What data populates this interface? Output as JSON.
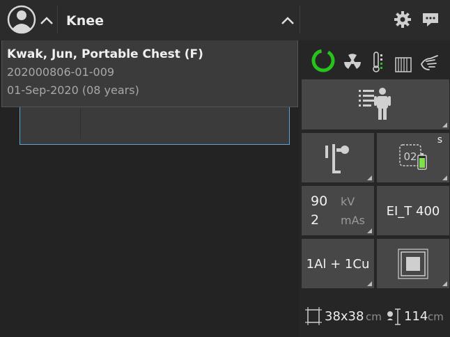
{
  "header": {
    "exam_title": "Knee"
  },
  "patient": {
    "name": "Kwak, Jun,  Portable Chest (F)",
    "id": "202000806-01-009",
    "dob": "01-Sep-2020 (08 years)"
  },
  "detector": {
    "number": "02",
    "badge": "s"
  },
  "exposure": {
    "kv_value": "90",
    "kv_unit": "kV",
    "mas_value": "2",
    "mas_unit": "mAs",
    "exposure_index": "EI_T 400",
    "filter": "1Al + 1Cu"
  },
  "geometry": {
    "field_size": "38x38",
    "field_size_unit": "cm",
    "sid": "114",
    "sid_unit": "cm"
  },
  "colors": {
    "ready_green": "#27c21b",
    "battery_green": "#7ee04a",
    "selection_blue": "#5fa6d6"
  },
  "icons": [
    "avatar-icon",
    "chevron-up-icon",
    "gear-icon",
    "chat-icon",
    "ready-ring-icon",
    "radiation-icon",
    "thermometer-icon",
    "grid-icon",
    "hand-icon",
    "patient-position-icon",
    "wall-stand-icon",
    "detector-battery-icon",
    "collimator-icon",
    "field-size-icon",
    "sid-icon"
  ]
}
